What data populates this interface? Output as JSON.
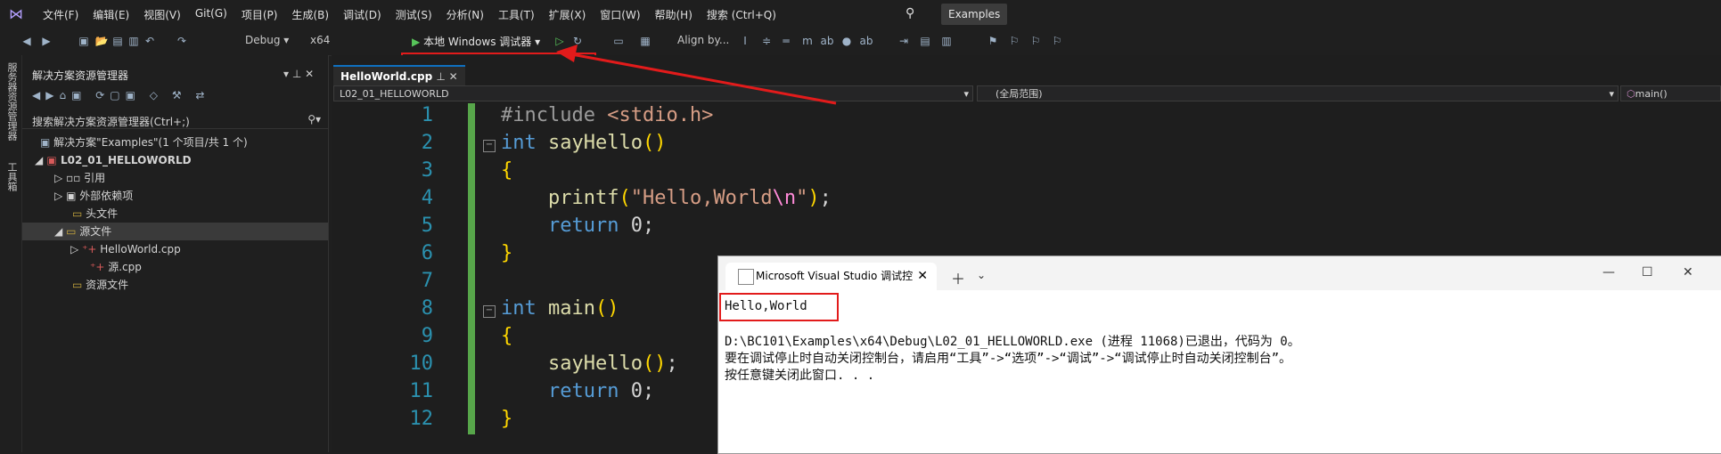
{
  "menu": [
    "文件(F)",
    "编辑(E)",
    "视图(V)",
    "Git(G)",
    "项目(P)",
    "生成(B)",
    "调试(D)",
    "测试(S)",
    "分析(N)",
    "工具(T)",
    "扩展(X)",
    "窗口(W)",
    "帮助(H)",
    "搜索 (Ctrl+Q)"
  ],
  "title_badge": "Examples",
  "toolbar": {
    "config": "Debug",
    "platform": "x64",
    "debugger": "本地 Windows 调试器",
    "align": "Align by..."
  },
  "sidebar_vertical": [
    "服务器资源管理器",
    "工具箱"
  ],
  "solution_explorer": {
    "title": "解决方案资源管理器",
    "search": "搜索解决方案资源管理器(Ctrl+;)",
    "items": [
      {
        "label": "解决方案\"Examples\"(1 个项目/共 1 个)",
        "indent": 0
      },
      {
        "label": "L02_01_HELLOWORLD",
        "indent": 1
      },
      {
        "label": "引用",
        "indent": 2
      },
      {
        "label": "外部依赖项",
        "indent": 2
      },
      {
        "label": "头文件",
        "indent": 2
      },
      {
        "label": "源文件",
        "indent": 2
      },
      {
        "label": "HelloWorld.cpp",
        "indent": 3
      },
      {
        "label": "源.cpp",
        "indent": 3
      },
      {
        "label": "资源文件",
        "indent": 2
      }
    ]
  },
  "editor": {
    "tab": "HelloWorld.cpp",
    "nav_project": "L02_01_HELLOWORLD",
    "nav_scope": "(全局范围)",
    "nav_member": "main()",
    "line_numbers": [
      "1",
      "2",
      "3",
      "4",
      "5",
      "6",
      "7",
      "8",
      "9",
      "10",
      "11",
      "12"
    ]
  },
  "console": {
    "tab_title": "Microsoft Visual Studio 调试控",
    "output": "Hello,World",
    "line1": "D:\\BC101\\Examples\\x64\\Debug\\L02_01_HELLOWORLD.exe (进程 11068)已退出，代码为 0。",
    "line2": "要在调试停止时自动关闭控制台，请启用“工具”->“选项”->“调试”->“调试停止时自动关闭控制台”。",
    "line3": "按任意键关闭此窗口. . ."
  },
  "colors": {
    "accent": "#0e70c0",
    "highlight": "#e21b1b",
    "success": "#57a64a"
  }
}
